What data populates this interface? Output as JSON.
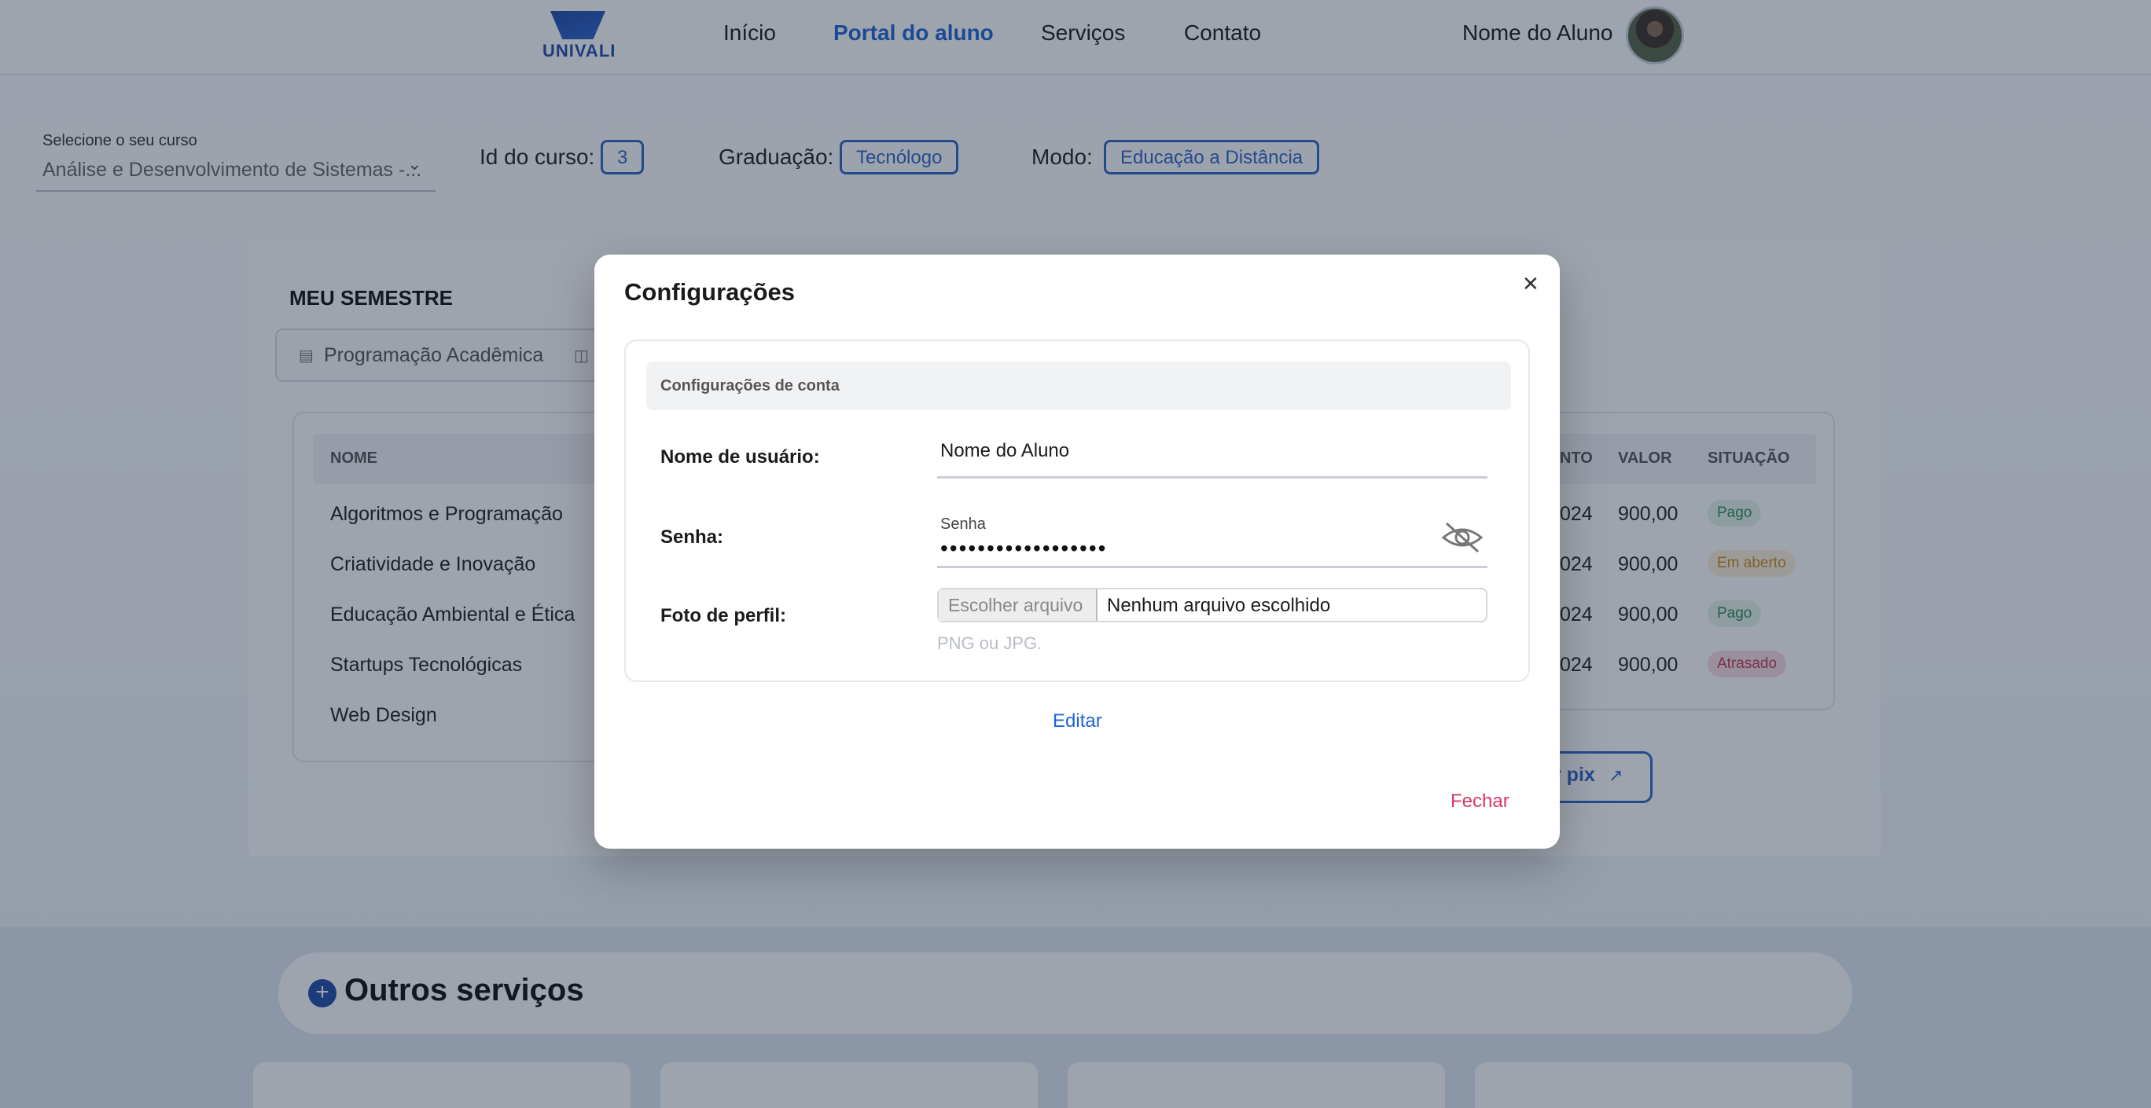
{
  "header": {
    "logo_text": "UNIVALI",
    "nav": [
      "Início",
      "Portal do aluno",
      "Serviços",
      "Contato"
    ],
    "active_nav": "Portal do aluno",
    "user_name": "Nome do Aluno"
  },
  "course": {
    "label": "Selecione o seu curso",
    "value": "Análise e Desenvolvimento de Sistemas -...",
    "id_label": "Id do curso:",
    "id_value": "3",
    "grad_label": "Graduação:",
    "grad_value": "Tecnólogo",
    "mode_label": "Modo:",
    "mode_value": "Educação a Distância"
  },
  "semester": {
    "title": "MEU SEMESTRE",
    "tab": "Programação Acadêmica",
    "col_name": "NOME",
    "rows": [
      "Algoritmos e Programação",
      "Criatividade e Inovação",
      "Educação Ambiental e Ética",
      "Startups Tecnológicas",
      "Web Design"
    ]
  },
  "finance": {
    "col_due_fragment": "NTO",
    "col_value": "VALOR",
    "col_status": "SITUAÇÃO",
    "rows": [
      {
        "date_fragment": "024",
        "value": "900,00",
        "status": "Pago",
        "color": "#2e8b57",
        "bg": "#e3f3e6"
      },
      {
        "date_fragment": "024",
        "value": "900,00",
        "status": "Em aberto",
        "color": "#c98a1c",
        "bg": "#fdf0d9"
      },
      {
        "date_fragment": "024",
        "value": "900,00",
        "status": "Pago",
        "color": "#2e8b57",
        "bg": "#e3f3e6"
      },
      {
        "date_fragment": "024",
        "value": "900,00",
        "status": "Atrasado",
        "color": "#c23a52",
        "bg": "#f9dde2"
      }
    ],
    "pix_fragment": "r pix"
  },
  "services": {
    "title": "Outros serviços"
  },
  "modal": {
    "title": "Configurações",
    "section": "Configurações de conta",
    "username_label": "Nome de usuário:",
    "username_value": "Nome do Aluno",
    "password_label": "Senha:",
    "password_small": "Senha",
    "password_value": "••••••••••••••••••",
    "photo_label": "Foto de perfil:",
    "file_button": "Escolher arquivo",
    "file_status": "Nenhum arquivo escolhido",
    "file_hint": "PNG ou JPG.",
    "edit_label": "Editar",
    "close_label": "Fechar"
  },
  "colors": {
    "primary": "#1f63d4",
    "danger": "#d63a62",
    "chip": "#2d64c8"
  }
}
